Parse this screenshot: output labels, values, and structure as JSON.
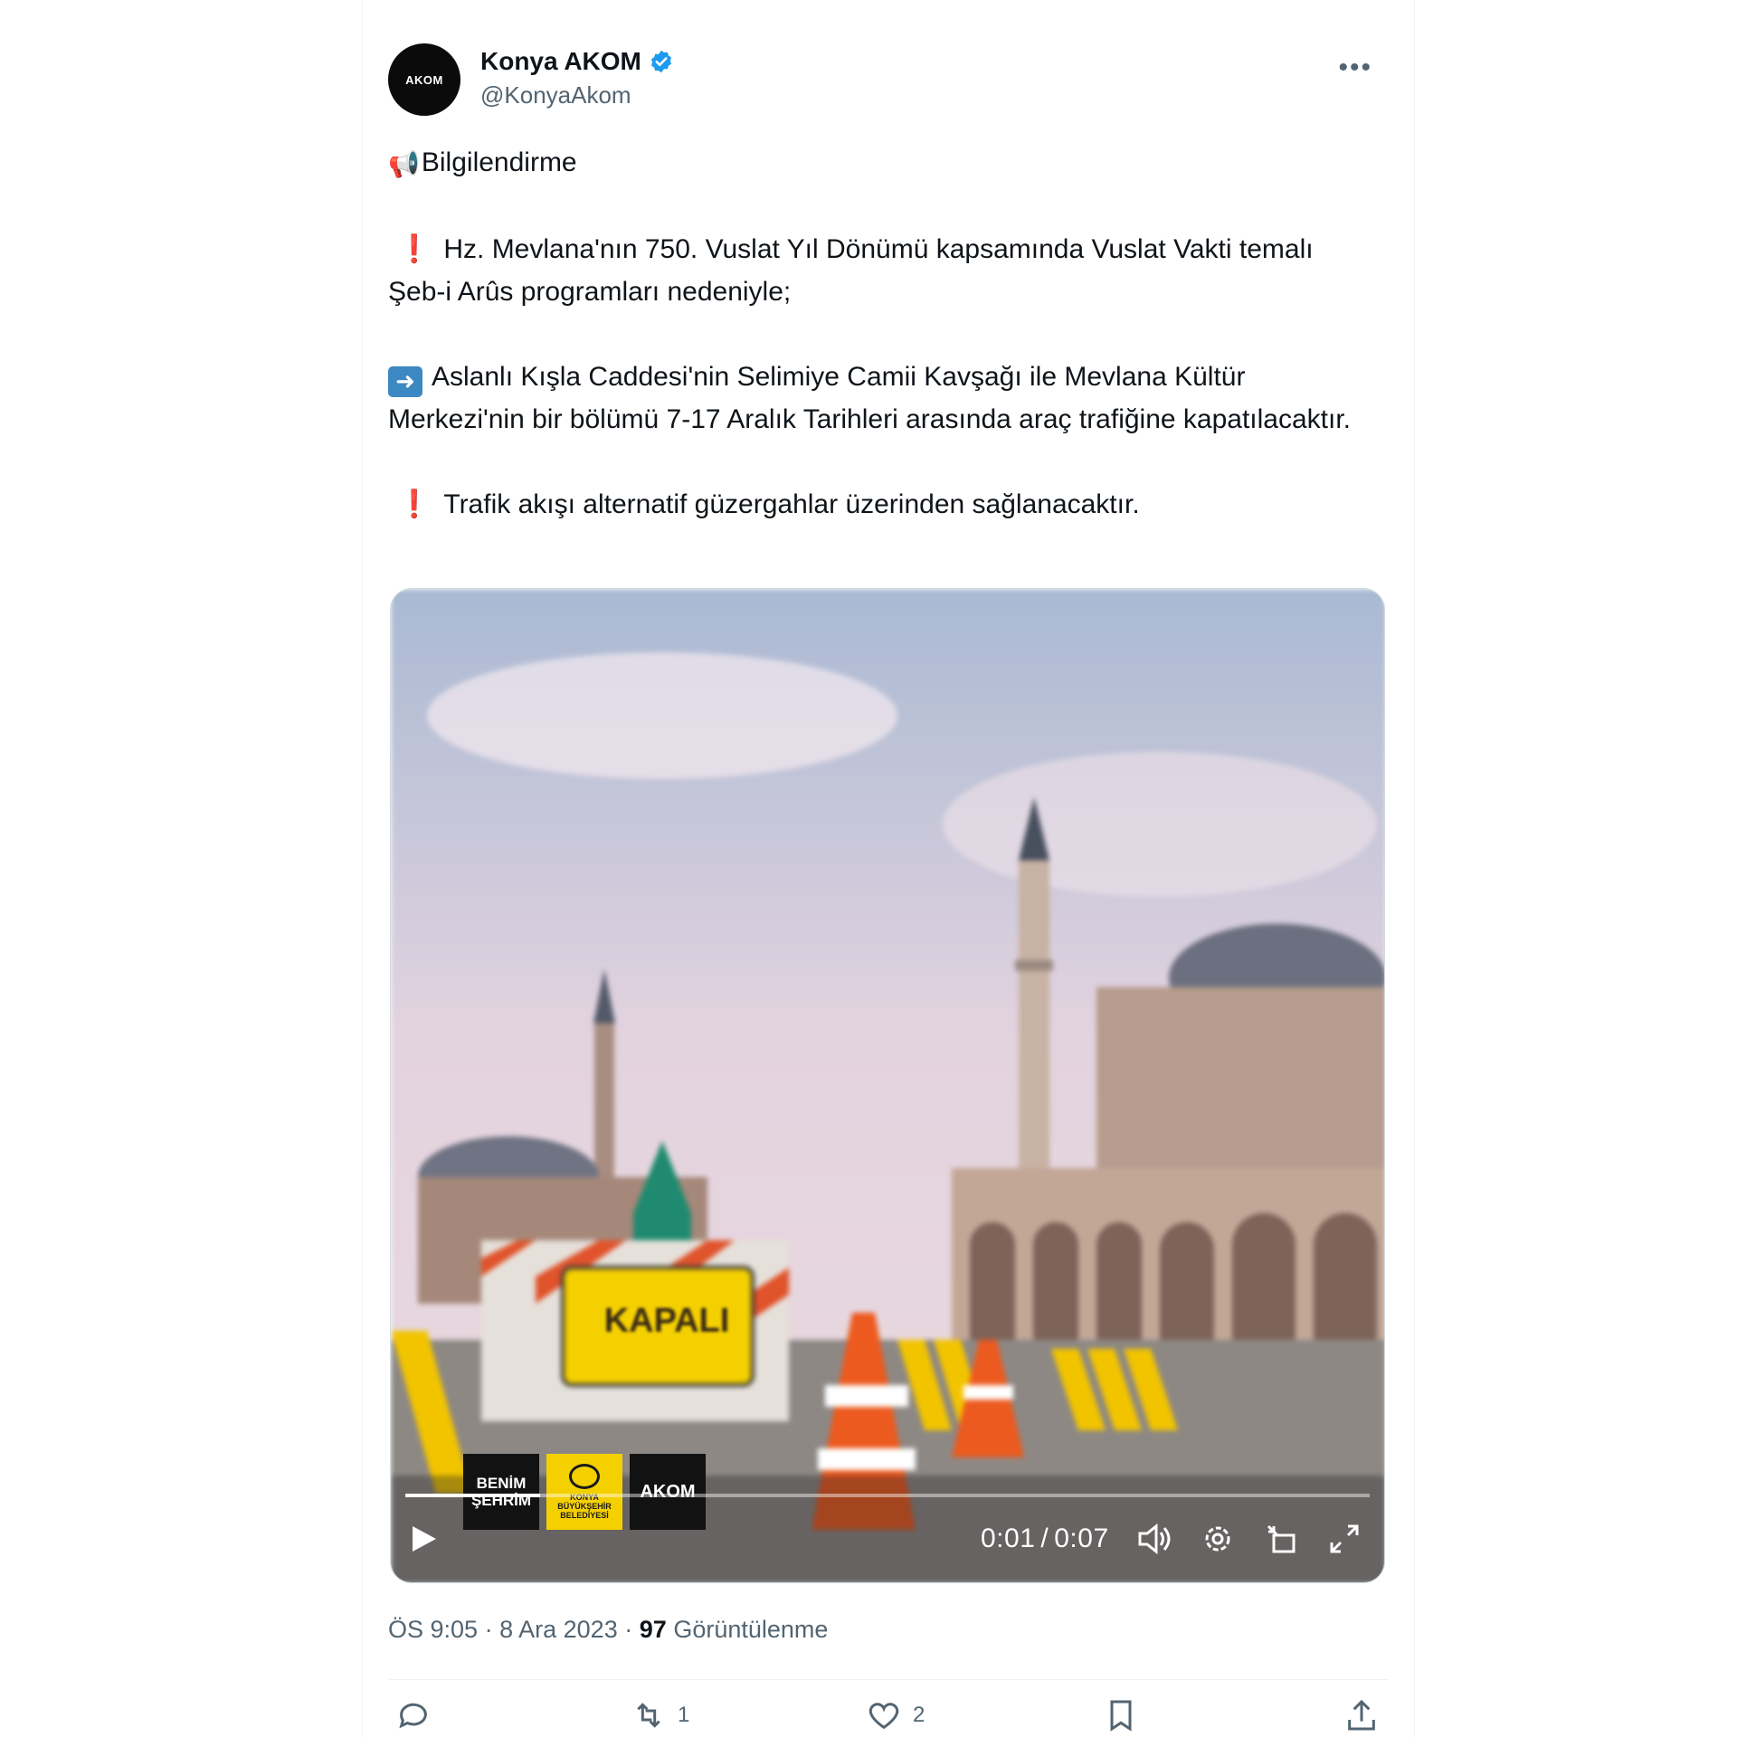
{
  "tweet": {
    "author": {
      "display_name": "Konya AKOM",
      "handle": "@KonyaAkom",
      "avatar_text": "AKOM"
    },
    "body": {
      "heading": "Bilgilendirme",
      "line1": "Hz. Mevlana'nın 750. Vuslat Yıl Dönümü kapsamında Vuslat Vakti temalı Şeb-i Arûs programları nedeniyle;",
      "line2": "Aslanlı Kışla Caddesi'nin Selimiye Camii Kavşağı ile Mevlana Kültür Merkezi'nin bir bölümü 7-17 Aralık Tarihleri arasında araç trafiğine kapatılacaktır.",
      "line3": "Trafik akışı alternatif güzergahlar üzerinden sağlanacaktır."
    },
    "media": {
      "sign_text": "KAPALI",
      "logos": [
        "BENİM ŞEHRİM",
        "KONYA BÜYÜKŞEHİR BELEDİYESİ",
        "AKOM"
      ],
      "player": {
        "current_time": "0:01",
        "separator": "/",
        "duration": "0:07",
        "progress_fraction": 0.14
      }
    },
    "meta": {
      "time": "ÖS 9:05",
      "dot1": "·",
      "date": "8 Ara 2023",
      "dot2": "·",
      "views": "97",
      "views_label": "Görüntülenme"
    },
    "actions": {
      "reply_count": "",
      "retweet_count": "1",
      "like_count": "2"
    }
  },
  "colors": {
    "text": "#0f1419",
    "muted": "#536471",
    "verified": "#1d9bf0",
    "accent_red": "#d40d2b",
    "arrow_blue": "#3b88c3",
    "sign_yellow": "#f5d000"
  },
  "icons": [
    "verified-badge-icon",
    "more-icon",
    "megaphone-icon",
    "exclamation-icon",
    "right-arrow-icon",
    "play-icon",
    "volume-icon",
    "settings-icon",
    "pip-icon",
    "fullscreen-icon",
    "reply-icon",
    "retweet-icon",
    "like-icon",
    "bookmark-icon",
    "share-icon"
  ]
}
